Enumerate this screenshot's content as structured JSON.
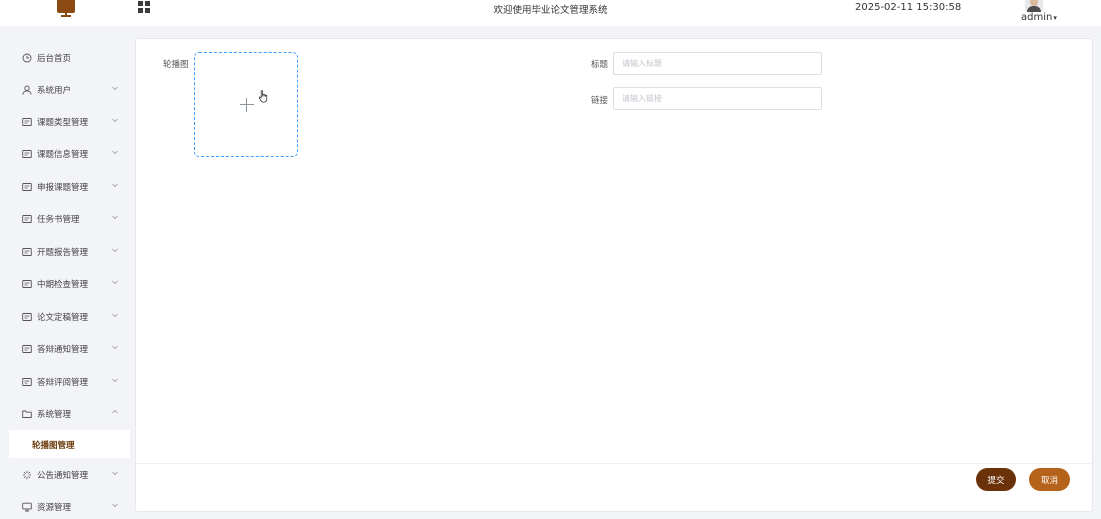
{
  "header": {
    "title": "欢迎使用毕业论文管理系统",
    "datetime": "2025-02-11 15:30:58",
    "username": "admin"
  },
  "sidebar": {
    "items": [
      {
        "label": "后台首页",
        "icon": "clock-icon",
        "expandable": false
      },
      {
        "label": "系统用户",
        "icon": "user-icon",
        "expandable": true,
        "expanded": false
      },
      {
        "label": "课题类型管理",
        "icon": "card-icon",
        "expandable": true,
        "expanded": false
      },
      {
        "label": "课题信息管理",
        "icon": "card-icon",
        "expandable": true,
        "expanded": false
      },
      {
        "label": "申报课题管理",
        "icon": "card-icon",
        "expandable": true,
        "expanded": false
      },
      {
        "label": "任务书管理",
        "icon": "card-icon",
        "expandable": true,
        "expanded": false
      },
      {
        "label": "开题报告管理",
        "icon": "card-icon",
        "expandable": true,
        "expanded": false
      },
      {
        "label": "中期检查管理",
        "icon": "card-icon",
        "expandable": true,
        "expanded": false
      },
      {
        "label": "论文定稿管理",
        "icon": "card-icon",
        "expandable": true,
        "expanded": false
      },
      {
        "label": "答辩通知管理",
        "icon": "card-icon",
        "expandable": true,
        "expanded": false
      },
      {
        "label": "答辩评阅管理",
        "icon": "card-icon",
        "expandable": true,
        "expanded": false
      },
      {
        "label": "系统管理",
        "icon": "folder-icon",
        "expandable": true,
        "expanded": true
      },
      {
        "label": "公告通知管理",
        "icon": "sparkle-icon",
        "expandable": true,
        "expanded": false
      },
      {
        "label": "资源管理",
        "icon": "monitor-icon",
        "expandable": true,
        "expanded": false
      }
    ],
    "active_subitem": {
      "label": "轮播图管理"
    }
  },
  "form": {
    "image_label": "轮播图",
    "title_label": "标题",
    "title_placeholder": "请输入标题",
    "title_value": "",
    "link_label": "链接",
    "link_placeholder": "请输入链接",
    "link_value": "",
    "submit_label": "提交",
    "cancel_label": "取消"
  },
  "colors": {
    "accent_dark": "#6b3108",
    "accent": "#b5631a",
    "active_text": "#6b3a0b",
    "upload_border": "#409eff"
  }
}
